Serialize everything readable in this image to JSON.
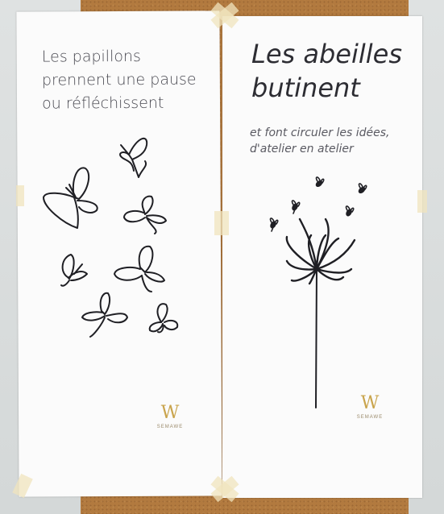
{
  "left_poster": {
    "lines": [
      "Les papillons",
      "prennent une pause",
      "ou réfléchissent"
    ],
    "logo_text": "SEMAWE"
  },
  "right_poster": {
    "title_lines": [
      "Les abeilles",
      "butinent"
    ],
    "subtitle_lines": [
      "et font circuler les idées,",
      "d'atelier en atelier"
    ],
    "logo_text": "SEMAWE"
  },
  "colors": {
    "cork": "#b27a3f",
    "paper": "#fbfbfb",
    "ink": "#1f1f24",
    "logo_gold": "#c9a44c"
  },
  "icons": [
    "butterfly-icon",
    "dandelion-flower-icon",
    "bee-icon",
    "semawe-logo"
  ]
}
